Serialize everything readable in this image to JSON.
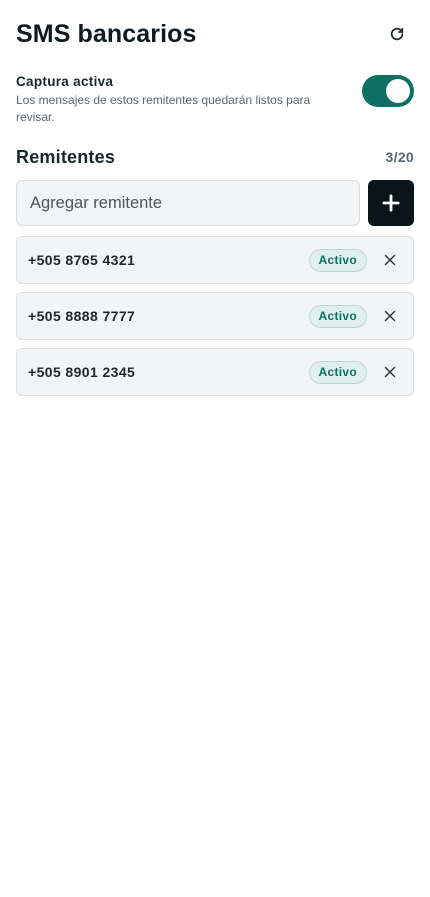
{
  "header": {
    "title": "SMS bancarios",
    "refresh_icon": "refresh-icon"
  },
  "capture": {
    "title": "Captura activa",
    "description": "Los mensajes de estos remitentes quedarán listos para revisar.",
    "enabled": true,
    "toggle_color": "#0e6f63"
  },
  "senders_section": {
    "title": "Remitentes",
    "count": "3/20"
  },
  "add_sender": {
    "placeholder": "Agregar remitente",
    "value": "",
    "button_icon": "plus-icon"
  },
  "senders": [
    {
      "number": "+505 8765 4321",
      "status": "Activo"
    },
    {
      "number": "+505 8888 7777",
      "status": "Activo"
    },
    {
      "number": "+505 8901 2345",
      "status": "Activo"
    }
  ],
  "colors": {
    "accent": "#0e6f63",
    "badge_bg": "#e0efec",
    "dark_button": "#0b1418"
  }
}
